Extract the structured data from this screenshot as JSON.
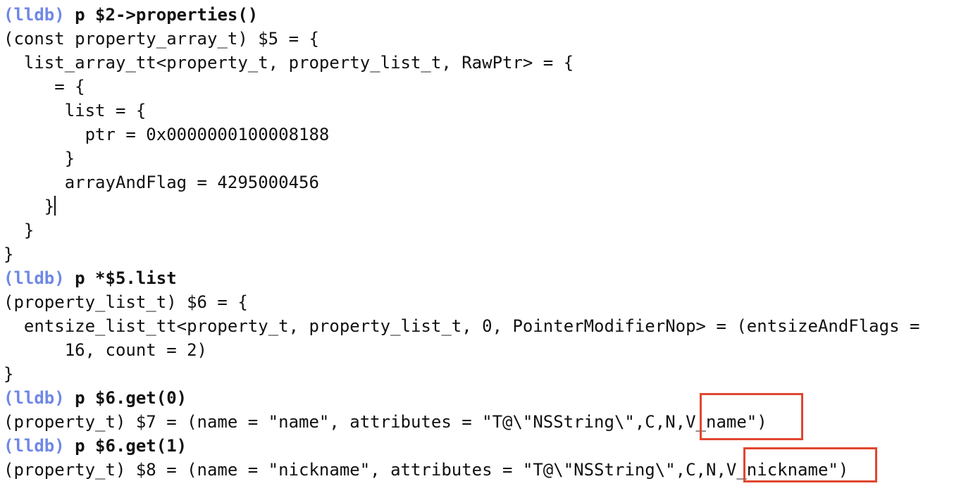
{
  "colors": {
    "prompt": "#6f87e6",
    "text": "#111111",
    "highlight": "#e0472f",
    "background": "#ffffff"
  },
  "prompt": "(lldb)",
  "lines": [
    {
      "prompt": "(lldb)",
      "cmd": " p $2->properties()"
    },
    {
      "text": "(const property_array_t) $5 = {"
    },
    {
      "text": "  list_array_tt<property_t, property_list_t, RawPtr> = {"
    },
    {
      "text": "     = {"
    },
    {
      "text": "      list = {"
    },
    {
      "text": "        ptr = 0x0000000100008188"
    },
    {
      "text": "      }"
    },
    {
      "text": "      arrayAndFlag = 4295000456"
    },
    {
      "text": "    }"
    },
    {
      "text": "  }"
    },
    {
      "text": "}"
    },
    {
      "prompt": "(lldb)",
      "cmd": " p *$5.list"
    },
    {
      "text": "(property_list_t) $6 = {"
    },
    {
      "text": "  entsize_list_tt<property_t, property_list_t, 0, PointerModifierNop> = (entsizeAndFlags ="
    },
    {
      "text": "      16, count = 2)"
    },
    {
      "text": "}"
    },
    {
      "prompt": "(lldb)",
      "cmd": " p $6.get(0)"
    },
    {
      "text": "(property_t) $7 = (name = \"name\", attributes = \"T@\\\"NSString\\\",C,N,V_name\")"
    },
    {
      "prompt": "(lldb)",
      "cmd": " p $6.get(1)"
    },
    {
      "text": "(property_t) $8 = (name = \"nickname\", attributes = \"T@\\\"NSString\\\",C,N,V_nickname\")"
    }
  ]
}
